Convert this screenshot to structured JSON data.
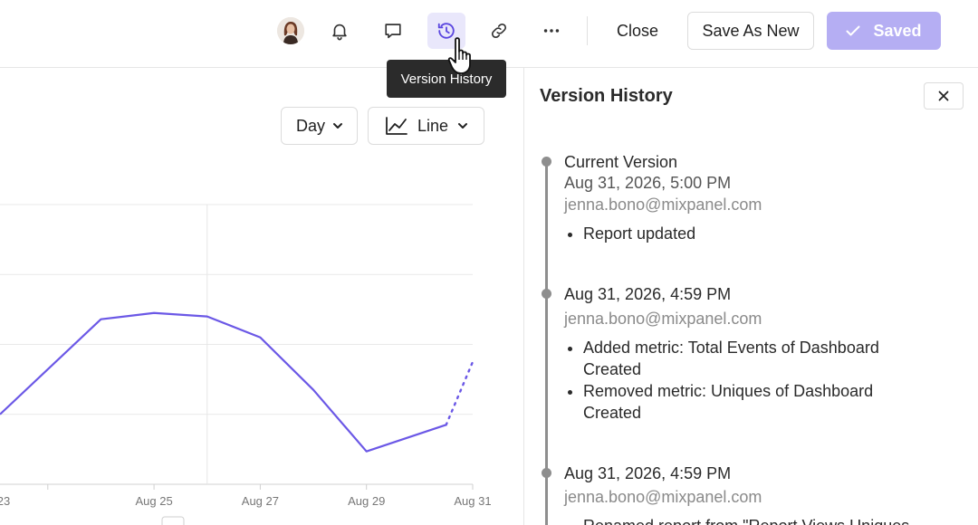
{
  "toolbar": {
    "close_label": "Close",
    "save_as_new_label": "Save As New",
    "saved_label": "Saved",
    "tooltip": "Version History",
    "accent_color": "#5b47e0",
    "saved_bg_color": "#b5aef3"
  },
  "icons": {
    "avatar": "user-avatar",
    "alerts": "bell-icon",
    "comments": "comment-icon",
    "history": "history-icon",
    "link": "link-icon",
    "more": "more-horizontal-icon",
    "check": "check-icon",
    "close": "close-icon",
    "line_chart": "line-chart-icon",
    "chevron": "chevron-down-icon"
  },
  "controls": {
    "interval": "Day",
    "chart_type": "Line"
  },
  "chart_data": {
    "type": "line",
    "x_ticks": [
      "23",
      "Aug 25",
      "Aug 27",
      "Aug 29",
      "Aug 31"
    ],
    "x_range": [
      22.1,
      31
    ],
    "y_range": [
      0,
      4
    ],
    "grid": true,
    "line_color": "#6b58e6",
    "series": [
      {
        "x": [
          22.1,
          24,
          25,
          26,
          27,
          28,
          29,
          30.5,
          31
        ],
        "y": [
          1,
          2.36,
          2.45,
          2.4,
          2.1,
          1.35,
          0.47,
          0.85,
          1.75
        ],
        "dotted_from_index": 7
      }
    ]
  },
  "panel": {
    "title": "Version History",
    "entries": [
      {
        "title": "Current Version",
        "date": "Aug 31, 2026, 5:00 PM",
        "email": "jenna.bono@mixpanel.com",
        "changes": [
          "Report updated"
        ]
      },
      {
        "title": "",
        "date": "Aug 31, 2026, 4:59 PM",
        "email": "jenna.bono@mixpanel.com",
        "changes": [
          "Added metric: Total Events of Dashboard Created",
          "Removed metric: Uniques of Dashboard Created"
        ]
      },
      {
        "title": "",
        "date": "Aug 31, 2026, 4:59 PM",
        "email": "jenna.bono@mixpanel.com",
        "changes": [
          "Renamed report from \"Report Views Uniques"
        ]
      }
    ]
  }
}
